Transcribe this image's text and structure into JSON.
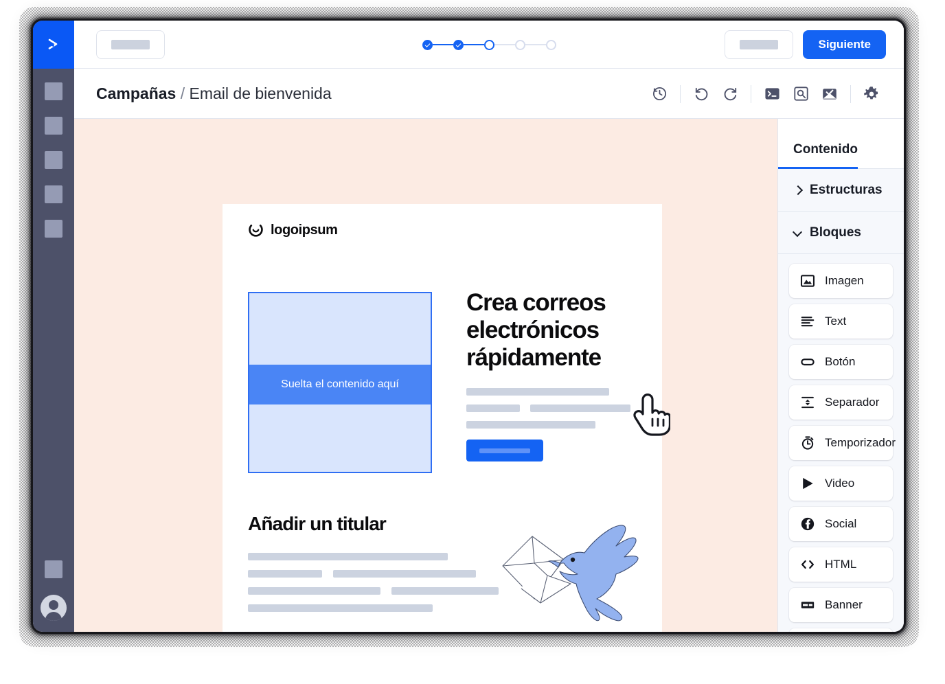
{
  "app": {
    "logo_icon": "chevron-right-logo",
    "accent_color": "#1463f3",
    "rail_color": "#4d5169",
    "canvas_bg": "#fcebe3"
  },
  "rail": {
    "items": [
      {
        "name": "rail-placeholder-1"
      },
      {
        "name": "rail-placeholder-2"
      },
      {
        "name": "rail-placeholder-3"
      },
      {
        "name": "rail-placeholder-4"
      },
      {
        "name": "rail-placeholder-5"
      }
    ],
    "bottom_placeholder": "rail-placeholder-6",
    "avatar_icon": "user-avatar-icon"
  },
  "topbar": {
    "back_button_label": "",
    "secondary_button_label": "",
    "next_label": "Siguiente",
    "stepper": {
      "total": 5,
      "current": 3,
      "states": [
        "done",
        "done",
        "current",
        "todo",
        "todo"
      ]
    }
  },
  "breadcrumb": {
    "root": "Campañas",
    "separator": "/",
    "current": "Email de bienvenida"
  },
  "toolbar": {
    "icons": [
      {
        "name": "history-icon",
        "title": "Historial"
      },
      {
        "name": "undo-icon",
        "title": "Deshacer"
      },
      {
        "name": "redo-icon",
        "title": "Rehacer"
      },
      {
        "name": "code-terminal-icon",
        "title": "Código"
      },
      {
        "name": "preview-icon",
        "title": "Vista previa"
      },
      {
        "name": "test-email-icon",
        "title": "Email de prueba"
      },
      {
        "name": "gear-icon",
        "title": "Ajustes"
      }
    ]
  },
  "email": {
    "logo_text": "logoipsum",
    "drop_zone_label": "Suelta el contenido aquí",
    "hero_heading": "Crea correos electrónicos rápidamente",
    "section_heading": "Añadir un titular",
    "illustration": "bird-carrying-envelope"
  },
  "panel": {
    "tab": "Contenido",
    "sections": [
      {
        "label": "Estructuras",
        "expanded": false
      },
      {
        "label": "Bloques",
        "expanded": true
      }
    ],
    "blocks": [
      {
        "label": "Imagen",
        "icon": "image-icon"
      },
      {
        "label": "Text",
        "icon": "text-lines-icon"
      },
      {
        "label": "Botón",
        "icon": "button-pill-icon"
      },
      {
        "label": "Separador",
        "icon": "separator-icon"
      },
      {
        "label": "Temporizador",
        "icon": "timer-icon"
      },
      {
        "label": "Video",
        "icon": "play-icon"
      },
      {
        "label": "Social",
        "icon": "facebook-icon"
      },
      {
        "label": "HTML",
        "icon": "code-brackets-icon"
      },
      {
        "label": "Banner",
        "icon": "banner-icon"
      }
    ]
  },
  "cursor": {
    "icon": "pointing-hand-cursor"
  }
}
